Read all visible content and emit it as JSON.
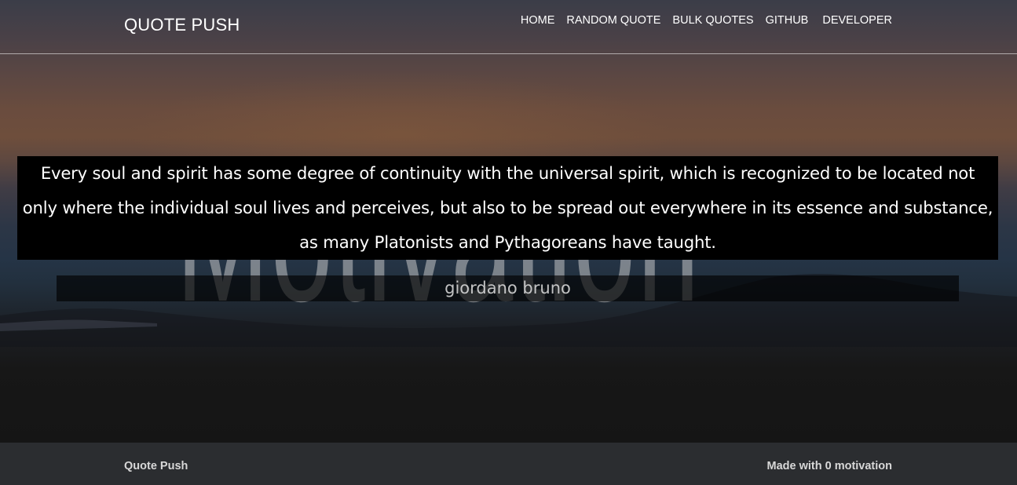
{
  "header": {
    "brand": "QUOTE PUSH",
    "nav": {
      "home": "HOME",
      "random_quote": "RANDOM QUOTE",
      "bulk_quotes": "BULK QUOTES",
      "github": "GITHUB",
      "developer": "DEVELOPER"
    }
  },
  "hero": {
    "background_word": "Motivation",
    "quote": "Every soul and spirit has some degree of continuity with the universal spirit, which is recognized to be located not only where the individual soul lives and perceives, but also to be spread out everywhere in its essence and substance, as many Platonists and Pythagoreans have taught.",
    "author": "giordano bruno"
  },
  "footer": {
    "left": "Quote Push",
    "right": "Made with 0 motivation"
  },
  "colors": {
    "quote_background": "#000000",
    "footer_background": "#2b2d30",
    "text": "#ffffff"
  }
}
